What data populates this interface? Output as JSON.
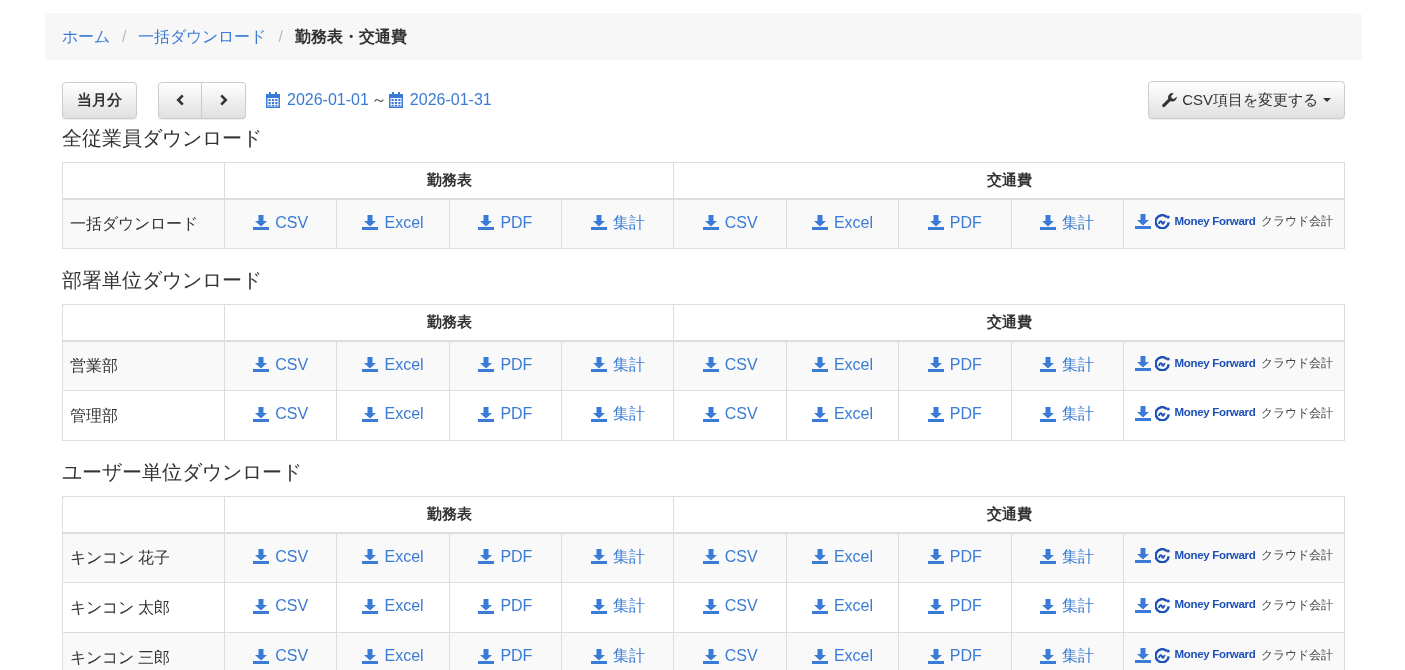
{
  "breadcrumb": {
    "items": [
      {
        "label": "ホーム",
        "current": false,
        "separator": "/"
      },
      {
        "label": "一括ダウンロード",
        "current": false,
        "separator": "/"
      },
      {
        "label": "勤務表・交通費",
        "current": true
      }
    ]
  },
  "toolbar": {
    "current_month_button": "当月分",
    "date_from": "2026-01-01",
    "range_separator": "～",
    "date_to": "2026-01-31",
    "csv_settings_button": "CSV項目を変更する"
  },
  "sections": [
    {
      "title": "全従業員ダウンロード",
      "column_groups": [
        "勤務表",
        "交通費"
      ],
      "rows": [
        {
          "label": "一括ダウンロード",
          "groups": [
            [
              {
                "kind": "link",
                "label": "CSV"
              },
              {
                "kind": "link",
                "label": "Excel"
              },
              {
                "kind": "link",
                "label": "PDF"
              },
              {
                "kind": "link",
                "label": "集計"
              }
            ],
            [
              {
                "kind": "link",
                "label": "CSV"
              },
              {
                "kind": "link",
                "label": "Excel"
              },
              {
                "kind": "link",
                "label": "PDF"
              },
              {
                "kind": "link",
                "label": "集計"
              },
              {
                "kind": "logo",
                "brand": "Money Forward",
                "service": "クラウド会計"
              }
            ]
          ]
        }
      ]
    },
    {
      "title": "部署単位ダウンロード",
      "column_groups": [
        "勤務表",
        "交通費"
      ],
      "rows": [
        {
          "label": "営業部",
          "groups": [
            [
              {
                "kind": "link",
                "label": "CSV"
              },
              {
                "kind": "link",
                "label": "Excel"
              },
              {
                "kind": "link",
                "label": "PDF"
              },
              {
                "kind": "link",
                "label": "集計"
              }
            ],
            [
              {
                "kind": "link",
                "label": "CSV"
              },
              {
                "kind": "link",
                "label": "Excel"
              },
              {
                "kind": "link",
                "label": "PDF"
              },
              {
                "kind": "link",
                "label": "集計"
              },
              {
                "kind": "logo",
                "brand": "Money Forward",
                "service": "クラウド会計"
              }
            ]
          ]
        },
        {
          "label": "管理部",
          "groups": [
            [
              {
                "kind": "link",
                "label": "CSV"
              },
              {
                "kind": "link",
                "label": "Excel"
              },
              {
                "kind": "link",
                "label": "PDF"
              },
              {
                "kind": "link",
                "label": "集計"
              }
            ],
            [
              {
                "kind": "link",
                "label": "CSV"
              },
              {
                "kind": "link",
                "label": "Excel"
              },
              {
                "kind": "link",
                "label": "PDF"
              },
              {
                "kind": "link",
                "label": "集計"
              },
              {
                "kind": "logo",
                "brand": "Money Forward",
                "service": "クラウド会計"
              }
            ]
          ]
        }
      ]
    },
    {
      "title": "ユーザー単位ダウンロード",
      "column_groups": [
        "勤務表",
        "交通費"
      ],
      "rows": [
        {
          "label": "キンコン 花子",
          "groups": [
            [
              {
                "kind": "link",
                "label": "CSV"
              },
              {
                "kind": "link",
                "label": "Excel"
              },
              {
                "kind": "link",
                "label": "PDF"
              },
              {
                "kind": "link",
                "label": "集計"
              }
            ],
            [
              {
                "kind": "link",
                "label": "CSV"
              },
              {
                "kind": "link",
                "label": "Excel"
              },
              {
                "kind": "link",
                "label": "PDF"
              },
              {
                "kind": "link",
                "label": "集計"
              },
              {
                "kind": "logo",
                "brand": "Money Forward",
                "service": "クラウド会計"
              }
            ]
          ]
        },
        {
          "label": "キンコン 太郎",
          "groups": [
            [
              {
                "kind": "link",
                "label": "CSV"
              },
              {
                "kind": "link",
                "label": "Excel"
              },
              {
                "kind": "link",
                "label": "PDF"
              },
              {
                "kind": "link",
                "label": "集計"
              }
            ],
            [
              {
                "kind": "link",
                "label": "CSV"
              },
              {
                "kind": "link",
                "label": "Excel"
              },
              {
                "kind": "link",
                "label": "PDF"
              },
              {
                "kind": "link",
                "label": "集計"
              },
              {
                "kind": "logo",
                "brand": "Money Forward",
                "service": "クラウド会計"
              }
            ]
          ]
        },
        {
          "label": "キンコン 三郎",
          "groups": [
            [
              {
                "kind": "link",
                "label": "CSV"
              },
              {
                "kind": "link",
                "label": "Excel"
              },
              {
                "kind": "link",
                "label": "PDF"
              },
              {
                "kind": "link",
                "label": "集計"
              }
            ],
            [
              {
                "kind": "link",
                "label": "CSV"
              },
              {
                "kind": "link",
                "label": "Excel"
              },
              {
                "kind": "link",
                "label": "PDF"
              },
              {
                "kind": "link",
                "label": "集計"
              },
              {
                "kind": "logo",
                "brand": "Money Forward",
                "service": "クラウド会計"
              }
            ]
          ]
        }
      ]
    }
  ]
}
